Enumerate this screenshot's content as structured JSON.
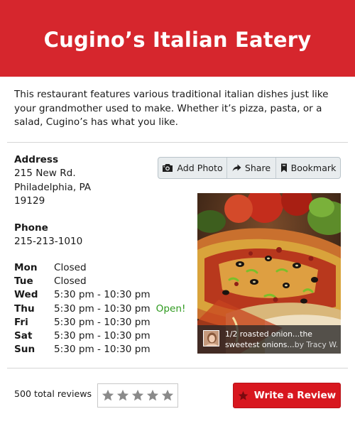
{
  "header": {
    "title": "Cugino’s Italian Eatery"
  },
  "description": "This restaurant features various traditional italian dishes just like your grandmother used to make. Whether it’s pizza, pasta, or a salad, Cugino’s has what you like.",
  "address": {
    "label": "Address",
    "line1": "215 New Rd.",
    "line2": "Philadelphia, PA",
    "line3": "19129"
  },
  "phone": {
    "label": "Phone",
    "number": "215-213-1010"
  },
  "hours": [
    {
      "day": "Mon",
      "time": "Closed",
      "status": ""
    },
    {
      "day": "Tue",
      "time": "Closed",
      "status": ""
    },
    {
      "day": "Wed",
      "time": "5:30 pm - 10:30 pm",
      "status": ""
    },
    {
      "day": "Thu",
      "time": "5:30 pm - 10:30 pm",
      "status": "Open!"
    },
    {
      "day": "Fri",
      "time": "5:30 pm - 10:30 pm",
      "status": ""
    },
    {
      "day": "Sat",
      "time": "5:30 pm - 10:30 pm",
      "status": ""
    },
    {
      "day": "Sun",
      "time": "5:30 pm - 10:30 pm",
      "status": ""
    }
  ],
  "actions": {
    "add_photo": {
      "label": "Add Photo",
      "icon": "camera-icon"
    },
    "share": {
      "label": "Share",
      "icon": "share-arrow-icon"
    },
    "bookmark": {
      "label": "Bookmark",
      "icon": "bookmark-icon"
    }
  },
  "photo": {
    "caption_line1": "1/2 roasted onion...the",
    "caption_line2": "sweetest onions...",
    "caption_by": "by Tracy W."
  },
  "reviews": {
    "total": "500 total reviews",
    "rating_stars": 0,
    "max_stars": 5,
    "write_label": "Write a Review"
  },
  "colors": {
    "brand_red": "#d6262d",
    "button_red": "#d8171f",
    "open_green": "#2e9a1e",
    "star_gray": "#8a8a8a"
  }
}
